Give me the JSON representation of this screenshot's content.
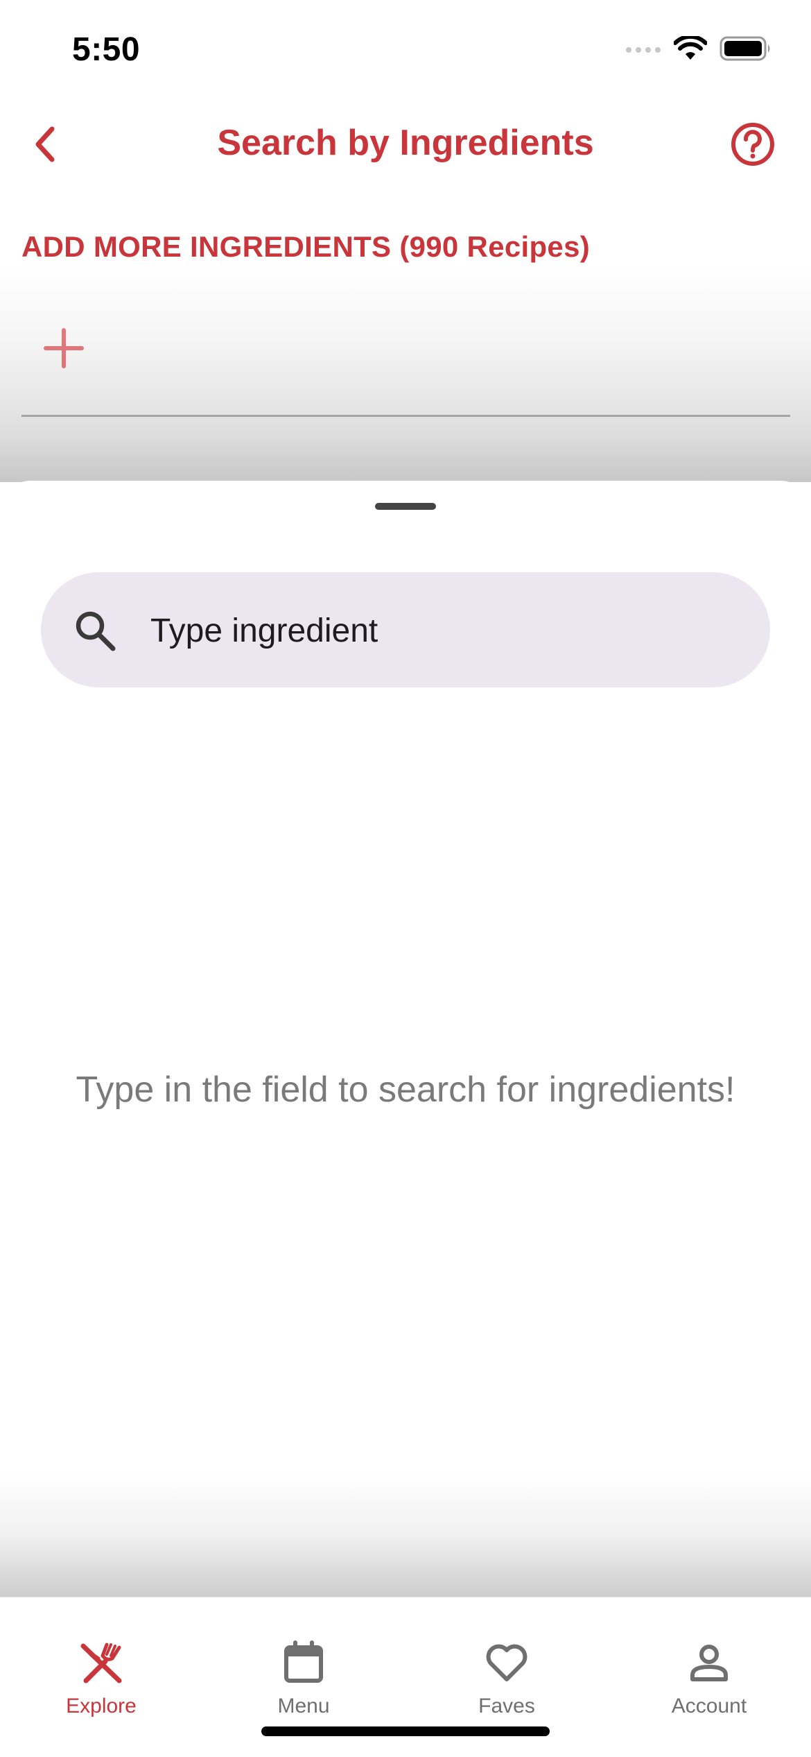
{
  "status_bar": {
    "time": "5:50"
  },
  "header": {
    "title": "Search by Ingredients",
    "back_icon": "chevron-left-icon",
    "help_icon": "question-circle-icon"
  },
  "ingredients": {
    "section_label": "ADD MORE INGREDIENTS (990 Recipes)",
    "add_icon": "plus-icon"
  },
  "search": {
    "placeholder": "Type ingredient",
    "value": "",
    "icon": "search-icon"
  },
  "empty_state": {
    "message": "Type in the field to search for ingredients!"
  },
  "bottom_nav": {
    "items": [
      {
        "label": "Explore",
        "icon": "fork-knife-icon",
        "active": true
      },
      {
        "label": "Menu",
        "icon": "calendar-icon",
        "active": false
      },
      {
        "label": "Faves",
        "icon": "heart-icon",
        "active": false
      },
      {
        "label": "Account",
        "icon": "person-icon",
        "active": false
      }
    ]
  },
  "colors": {
    "accent": "#C8363B",
    "search_fill": "#ECE6F0",
    "muted_text": "#7A7A7A"
  }
}
